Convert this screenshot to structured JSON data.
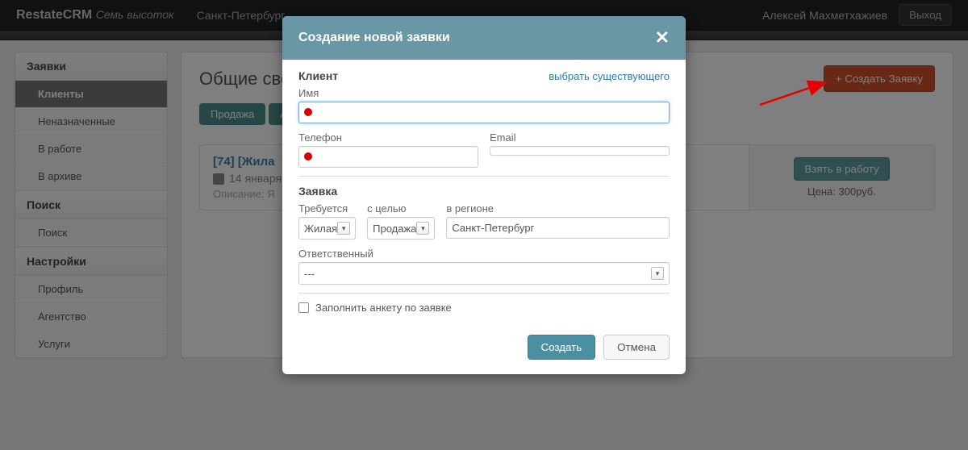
{
  "topbar": {
    "brand": "RestateCRM",
    "brand_sub": "Семь высоток",
    "nav1": "Санкт-Петербург",
    "user": "Алексей Махметхажиев",
    "exit": "Выход"
  },
  "sidebar": {
    "heads": {
      "requests": "Заявки",
      "search": "Поиск",
      "settings": "Настройки"
    },
    "items": {
      "clients": "Клиенты",
      "unassigned": "Неназначенные",
      "in_work": "В работе",
      "archive": "В архиве",
      "search": "Поиск",
      "profile": "Профиль",
      "agency": "Агентство",
      "services": "Услуги"
    }
  },
  "main": {
    "title": "Общие сво",
    "create_btn": "+ Создать Заявку",
    "tabs": {
      "sale": "Продажа",
      "other": "А"
    },
    "card": {
      "title": "[74] [Жила",
      "date": "14 января",
      "desc_label": "Описание:",
      "desc_val": "Я",
      "take_btn": "Взять в работу",
      "price": "Цена: 300руб."
    }
  },
  "modal": {
    "title": "Создание новой заявки",
    "client": {
      "head": "Клиент",
      "existing": "выбрать существующего",
      "name_label": "Имя",
      "phone_label": "Телефон",
      "email_label": "Email"
    },
    "request": {
      "head": "Заявка",
      "req_label": "Требуется",
      "purpose_label": "с целью",
      "region_label": "в регионе",
      "req_value": "Жилая",
      "purpose_value": "Продажа",
      "region_value": "Санкт-Петербург",
      "responsible_label": "Ответственный",
      "responsible_value": "---",
      "fill_form": "Заполнить анкету по заявке"
    },
    "submit": "Создать",
    "cancel": "Отмена"
  }
}
